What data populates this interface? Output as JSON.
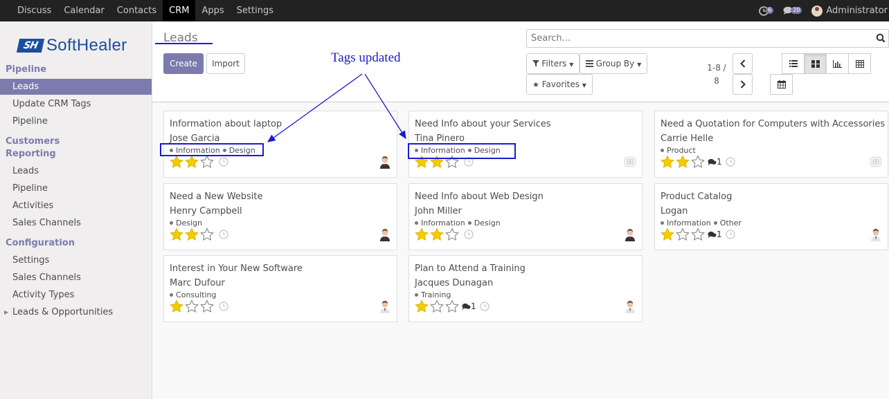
{
  "topbar": {
    "apps": [
      "Discuss",
      "Calendar",
      "Contacts",
      "CRM",
      "Apps",
      "Settings"
    ],
    "active": "CRM",
    "activity_count": "6",
    "message_count": "20",
    "user_name": "Administrator"
  },
  "sidebar": {
    "logo_mark": "SH",
    "logo_text": "SoftHealer",
    "pipeline_title": "Pipeline",
    "pipeline_items": [
      "Leads",
      "Update CRM Tags",
      "Pipeline"
    ],
    "customers_title": "Customers",
    "reporting_title": "Reporting",
    "reporting_items": [
      "Leads",
      "Pipeline",
      "Activities",
      "Sales Channels"
    ],
    "config_title": "Configuration",
    "config_items": [
      "Settings",
      "Sales Channels",
      "Activity Types",
      "Leads & Opportunities"
    ]
  },
  "control": {
    "breadcrumb": "Leads",
    "create_label": "Create",
    "import_label": "Import",
    "search_placeholder": "Search...",
    "filters_label": "Filters",
    "groupby_label": "Group By",
    "favorites_label": "Favorites",
    "pager_range": "1-8 /",
    "pager_total": "8"
  },
  "annotation": {
    "text": "Tags updated"
  },
  "cards": [
    {
      "title": "Information about laptop",
      "contact": "Jose Garcia",
      "tags": [
        "Information",
        "Design"
      ],
      "stars": 2,
      "messages": "",
      "avatar": "person-photo"
    },
    {
      "title": "Need Info about your Services",
      "contact": "Tina Pinero",
      "tags": [
        "Information",
        "Design"
      ],
      "stars": 2,
      "messages": "",
      "avatar": "placeholder"
    },
    {
      "title": "Need a Quotation for Computers with Accessories",
      "contact": "Carrie Helle",
      "tags": [
        "Product"
      ],
      "stars": 2,
      "messages": "1",
      "avatar": "placeholder"
    },
    {
      "title": "Need a New Website",
      "contact": "Henry Campbell",
      "tags": [
        "Design"
      ],
      "stars": 2,
      "messages": "",
      "avatar": "person-photo"
    },
    {
      "title": "Need Info about Web Design",
      "contact": "John Miller",
      "tags": [
        "Information",
        "Design"
      ],
      "stars": 2,
      "messages": "",
      "avatar": "person-photo"
    },
    {
      "title": "Product Catalog",
      "contact": "Logan",
      "tags": [
        "Information",
        "Other"
      ],
      "stars": 1,
      "messages": "1",
      "avatar": "person-photo-2"
    },
    {
      "title": "Interest in Your New Software",
      "contact": "Marc Dufour",
      "tags": [
        "Consulting"
      ],
      "stars": 1,
      "messages": "",
      "avatar": "person-photo-2"
    },
    {
      "title": "Plan to Attend a Training",
      "contact": "Jacques Dunagan",
      "tags": [
        "Training"
      ],
      "stars": 1,
      "messages": "1",
      "avatar": "person-photo-2"
    }
  ],
  "colors": {
    "accent": "#7c7bad",
    "star": "#f3cc00",
    "annotation": "#1a1acc"
  }
}
